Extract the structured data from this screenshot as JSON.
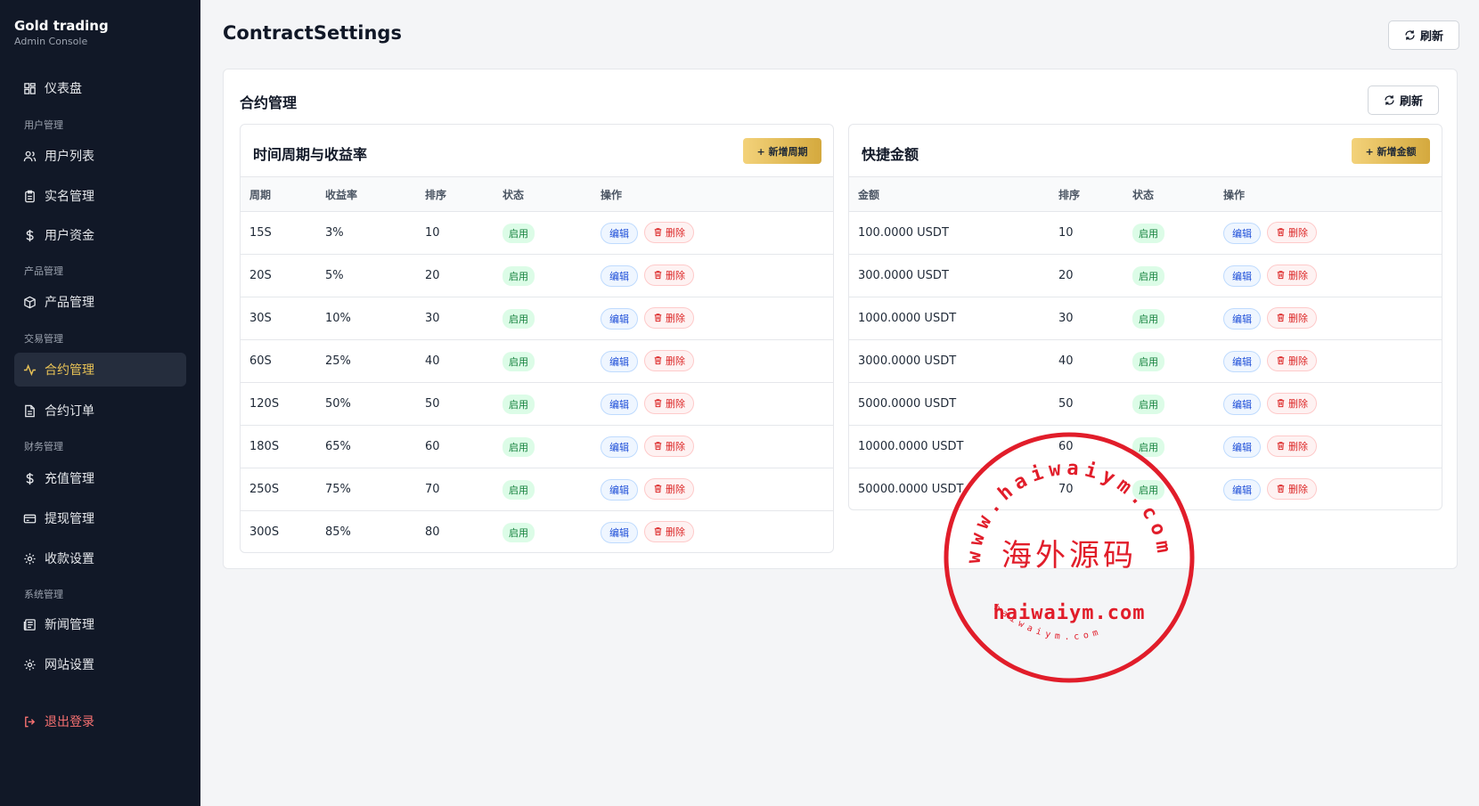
{
  "sidebar": {
    "brand_title": "Gold trading",
    "brand_sub": "Admin Console",
    "groups": {
      "user": "用户管理",
      "product": "产品管理",
      "trade": "交易管理",
      "finance": "财务管理",
      "system": "系统管理"
    },
    "items": {
      "dashboard": "仪表盘",
      "user_list": "用户列表",
      "real_name": "实名管理",
      "user_funds": "用户资金",
      "products": "产品管理",
      "contracts": "合约管理",
      "contract_orders": "合约订单",
      "recharge": "充值管理",
      "withdraw": "提现管理",
      "payment_settings": "收款设置",
      "news": "新闻管理",
      "site_settings": "网站设置",
      "logout": "退出登录"
    }
  },
  "header": {
    "title": "ContractSettings",
    "refresh_label": "刷新"
  },
  "card": {
    "title": "合约管理",
    "refresh_label": "刷新"
  },
  "period_panel": {
    "title": "时间周期与收益率",
    "add_label": "+ 新增周期",
    "columns": [
      "周期",
      "收益率",
      "排序",
      "状态",
      "操作"
    ],
    "rows": [
      {
        "period": "15S",
        "rate": "3%",
        "sort": "10",
        "status": "启用"
      },
      {
        "period": "20S",
        "rate": "5%",
        "sort": "20",
        "status": "启用"
      },
      {
        "period": "30S",
        "rate": "10%",
        "sort": "30",
        "status": "启用"
      },
      {
        "period": "60S",
        "rate": "25%",
        "sort": "40",
        "status": "启用"
      },
      {
        "period": "120S",
        "rate": "50%",
        "sort": "50",
        "status": "启用"
      },
      {
        "period": "180S",
        "rate": "65%",
        "sort": "60",
        "status": "启用"
      },
      {
        "period": "250S",
        "rate": "75%",
        "sort": "70",
        "status": "启用"
      },
      {
        "period": "300S",
        "rate": "85%",
        "sort": "80",
        "status": "启用"
      }
    ]
  },
  "amount_panel": {
    "title": "快捷金额",
    "add_label": "+ 新增金额",
    "columns": [
      "金额",
      "排序",
      "状态",
      "操作"
    ],
    "rows": [
      {
        "amount": "100.0000 USDT",
        "sort": "10",
        "status": "启用"
      },
      {
        "amount": "300.0000 USDT",
        "sort": "20",
        "status": "启用"
      },
      {
        "amount": "1000.0000 USDT",
        "sort": "30",
        "status": "启用"
      },
      {
        "amount": "3000.0000 USDT",
        "sort": "40",
        "status": "启用"
      },
      {
        "amount": "5000.0000 USDT",
        "sort": "50",
        "status": "启用"
      },
      {
        "amount": "10000.0000 USDT",
        "sort": "60",
        "status": "启用"
      },
      {
        "amount": "50000.0000 USDT",
        "sort": "70",
        "status": "启用"
      }
    ]
  },
  "actions": {
    "edit_label": "编辑",
    "delete_label": "删除"
  },
  "watermark": {
    "ring_text": "www.haiwaiym.com",
    "center_text": "海外源码",
    "domain_text": "haiwaiym.com",
    "small_text": "haiwaiym.com"
  }
}
